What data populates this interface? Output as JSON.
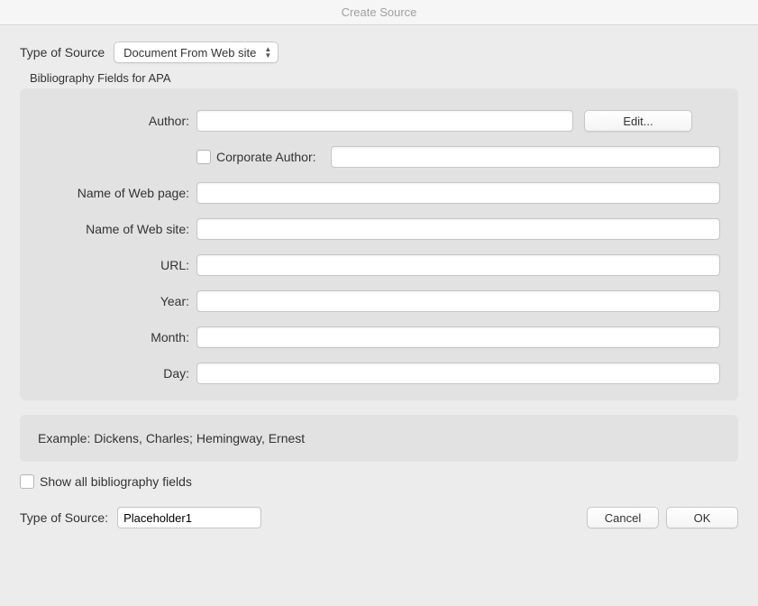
{
  "window": {
    "title": "Create Source"
  },
  "typeOfSource": {
    "label": "Type of Source",
    "selected": "Document From Web site"
  },
  "fieldset": {
    "legend": "Bibliography Fields for APA",
    "author": {
      "label": "Author:",
      "value": "",
      "editButton": "Edit..."
    },
    "corporateAuthor": {
      "label": "Corporate Author:",
      "checked": false,
      "value": ""
    },
    "nameOfWebPage": {
      "label": "Name of Web page:",
      "value": ""
    },
    "nameOfWebSite": {
      "label": "Name of Web site:",
      "value": ""
    },
    "url": {
      "label": "URL:",
      "value": ""
    },
    "year": {
      "label": "Year:",
      "value": ""
    },
    "month": {
      "label": "Month:",
      "value": ""
    },
    "day": {
      "label": "Day:",
      "value": ""
    }
  },
  "example": {
    "text": "Example: Dickens, Charles; Hemingway, Ernest"
  },
  "showAll": {
    "label": "Show all bibliography fields",
    "checked": false
  },
  "footer": {
    "label": "Type of Source:",
    "value": "Placeholder1",
    "cancel": "Cancel",
    "ok": "OK"
  }
}
